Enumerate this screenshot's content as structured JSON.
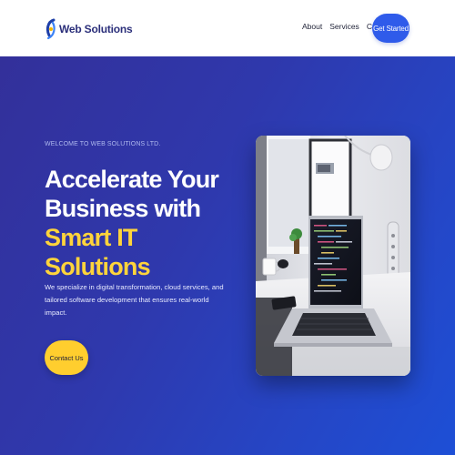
{
  "header": {
    "brand_name": "Web Solutions",
    "nav": [
      {
        "label": "About"
      },
      {
        "label": "Services"
      },
      {
        "label": "Contact"
      }
    ],
    "cta_label": "Get Started"
  },
  "hero": {
    "eyebrow": "WELCOME TO WEB SOLUTIONS LTD.",
    "headline_line1": "Accelerate Your",
    "headline_line2": "Business with",
    "headline_accent": "Smart IT Solutions",
    "description": "We specialize in digital transformation, cloud services, and tailored software development that ensures real-world impact.",
    "contact_label": "Contact Us"
  },
  "colors": {
    "brand_dark": "#2b2f7a",
    "primary_blue": "#2f5bea",
    "accent_yellow": "#ffd43b",
    "hero_gradient_start": "#33309a",
    "hero_gradient_end": "#1d4fd6"
  },
  "icons": {
    "logo": "web-solutions-logo"
  }
}
